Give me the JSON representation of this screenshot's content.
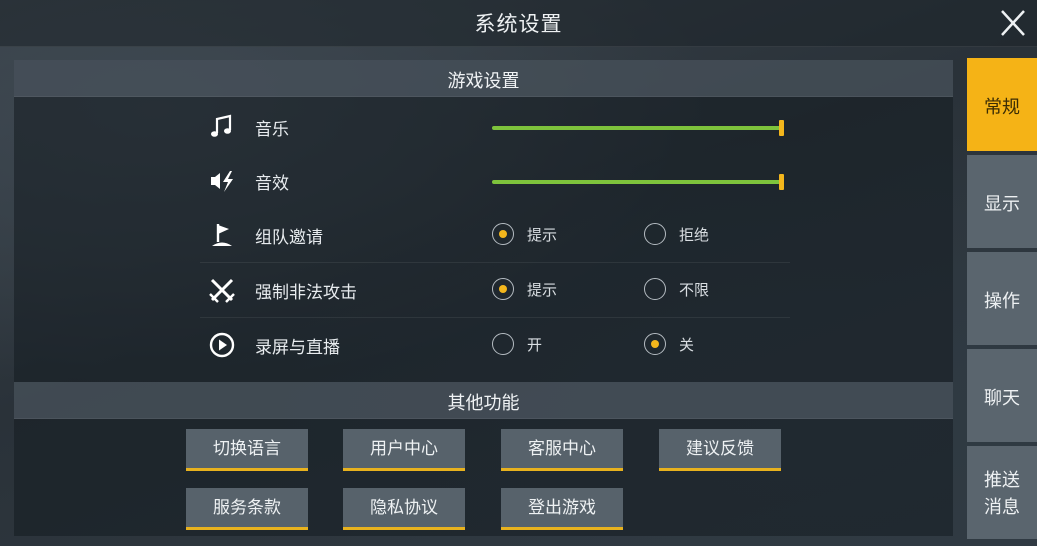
{
  "header": {
    "title": "系统设置"
  },
  "sections": {
    "game": {
      "title": "游戏设置"
    },
    "other": {
      "title": "其他功能"
    }
  },
  "settings": {
    "music": {
      "label": "音乐",
      "icon": "music-note-icon",
      "level": 1.0
    },
    "sfx": {
      "label": "音效",
      "icon": "sound-effect-icon",
      "level": 1.0
    },
    "team_invite": {
      "label": "组队邀请",
      "icon": "flag-icon",
      "options": [
        "提示",
        "拒绝"
      ],
      "selected": "提示"
    },
    "forced_attack": {
      "label": "强制非法攻击",
      "icon": "crossed-swords-icon",
      "options": [
        "提示",
        "不限"
      ],
      "selected": "提示"
    },
    "recording": {
      "label": "录屏与直播",
      "icon": "play-circle-icon",
      "options": [
        "开",
        "关"
      ],
      "selected": "关"
    }
  },
  "buttons": [
    "切换语言",
    "用户中心",
    "客服中心",
    "建议反馈",
    "服务条款",
    "隐私协议",
    "登出游戏"
  ],
  "tabs": [
    {
      "label": "常规",
      "active": true
    },
    {
      "label": "显示",
      "active": false
    },
    {
      "label": "操作",
      "active": false
    },
    {
      "label": "聊天",
      "active": false
    },
    {
      "label": "推送\n消息",
      "active": false
    }
  ],
  "colors": {
    "accent": "#f5b316",
    "slider_fill": "#7ec33c",
    "button_bg": "#57626b",
    "tab_bg": "#5a656e"
  }
}
